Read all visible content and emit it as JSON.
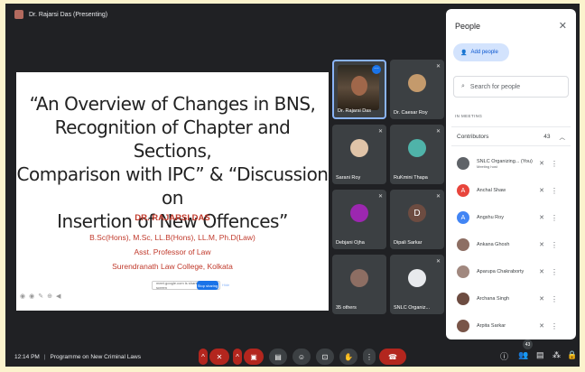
{
  "meeting": {
    "presenting_label": "Dr. Rajarsi Das (Presenting)",
    "time": "12:14 PM",
    "separator": "|",
    "title": "Programme on New Criminal Laws"
  },
  "slide": {
    "title_lines": [
      "“An Overview of Changes in BNS,",
      "Recognition of Chapter and Sections,",
      "Comparison with IPC” & “Discussion on",
      "Insertion of New Offences”"
    ],
    "presenter_name": "DR. RAJARSI DAS",
    "credential_lines": [
      "B.Sc(Hons), M.Sc, LL.B(Hons), LL.M, Ph.D(Law)",
      "Asst. Professor of Law",
      "Surendranath Law College, Kolkata"
    ],
    "share_bar_text": "meet.google.com is sharing your screen",
    "stop_sharing_label": "Stop sharing",
    "hide_label": "Hide"
  },
  "tiles": [
    {
      "name": "Dr. Rajarsi Das"
    },
    {
      "name": "Dr. Caesar Roy"
    },
    {
      "name": "Sarani Roy"
    },
    {
      "name": "RuKmini Thapa"
    },
    {
      "name": "Debjani Ojha"
    },
    {
      "name": "Dipali Sarkar",
      "letter": "D"
    },
    {
      "name": "35 others"
    },
    {
      "name": "SNLC Organiz..."
    }
  ],
  "people_panel": {
    "title": "People",
    "add_people_label": "Add people",
    "search_placeholder": "Search for people",
    "section_label": "IN MEETING",
    "group_label": "Contributors",
    "group_count": "43",
    "participants": [
      {
        "name": "SNLC Organizing... (You)",
        "sub": "Meeting host",
        "letter": "",
        "color": "#5f6368"
      },
      {
        "name": "Anchal Shaw",
        "sub": "",
        "letter": "A",
        "color": "#e8453c"
      },
      {
        "name": "Angshu Roy",
        "sub": "",
        "letter": "A",
        "color": "#4285f4"
      },
      {
        "name": "Ankana Ghosh",
        "sub": "",
        "letter": "",
        "color": "#8d6e63"
      },
      {
        "name": "Aparupa Chakraborty",
        "sub": "",
        "letter": "",
        "color": "#a1887f"
      },
      {
        "name": "Archana Singh",
        "sub": "",
        "letter": "",
        "color": "#6d4c41"
      },
      {
        "name": "Arpita Sarkar",
        "sub": "",
        "letter": "",
        "color": "#795548"
      }
    ]
  },
  "controls": {
    "participants_badge": "43"
  },
  "colors": {
    "background": "#fbf3cd",
    "meet_dark": "#202124",
    "accent_red": "#b3261e",
    "slide_accent": "#c0392b"
  }
}
